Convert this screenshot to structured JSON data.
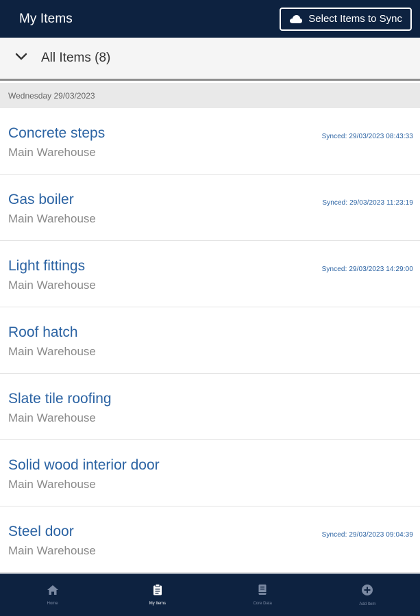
{
  "header": {
    "title": "My Items",
    "sync_button_label": "Select Items to Sync",
    "sync_icon": "cloud-icon"
  },
  "group": {
    "label": "All Items (8)",
    "toggle_icon": "chevron-down-icon"
  },
  "date_header": "Wednesday 29/03/2023",
  "items": [
    {
      "name": "Concrete steps",
      "location": "Main Warehouse",
      "synced": "Synced: 29/03/2023 08:43:33"
    },
    {
      "name": "Gas boiler",
      "location": "Main Warehouse",
      "synced": "Synced: 29/03/2023 11:23:19"
    },
    {
      "name": "Light fittings",
      "location": "Main Warehouse",
      "synced": "Synced: 29/03/2023 14:29:00"
    },
    {
      "name": "Roof hatch",
      "location": "Main Warehouse",
      "synced": ""
    },
    {
      "name": "Slate tile roofing",
      "location": "Main Warehouse",
      "synced": ""
    },
    {
      "name": "Solid wood interior door",
      "location": "Main Warehouse",
      "synced": ""
    },
    {
      "name": "Steel door",
      "location": "Main Warehouse",
      "synced": "Synced: 29/03/2023 09:04:39"
    }
  ],
  "bottom_nav": [
    {
      "label": "Home",
      "icon": "home-icon",
      "active": false
    },
    {
      "label": "My Items",
      "icon": "clipboard-icon",
      "active": true
    },
    {
      "label": "Core Data",
      "icon": "book-icon",
      "active": false
    },
    {
      "label": "Add Item",
      "icon": "plus-circle-icon",
      "active": false
    }
  ],
  "colors": {
    "header_bg": "#0d2240",
    "link_blue": "#2b63a3",
    "secondary_text": "#8a8a8a"
  }
}
